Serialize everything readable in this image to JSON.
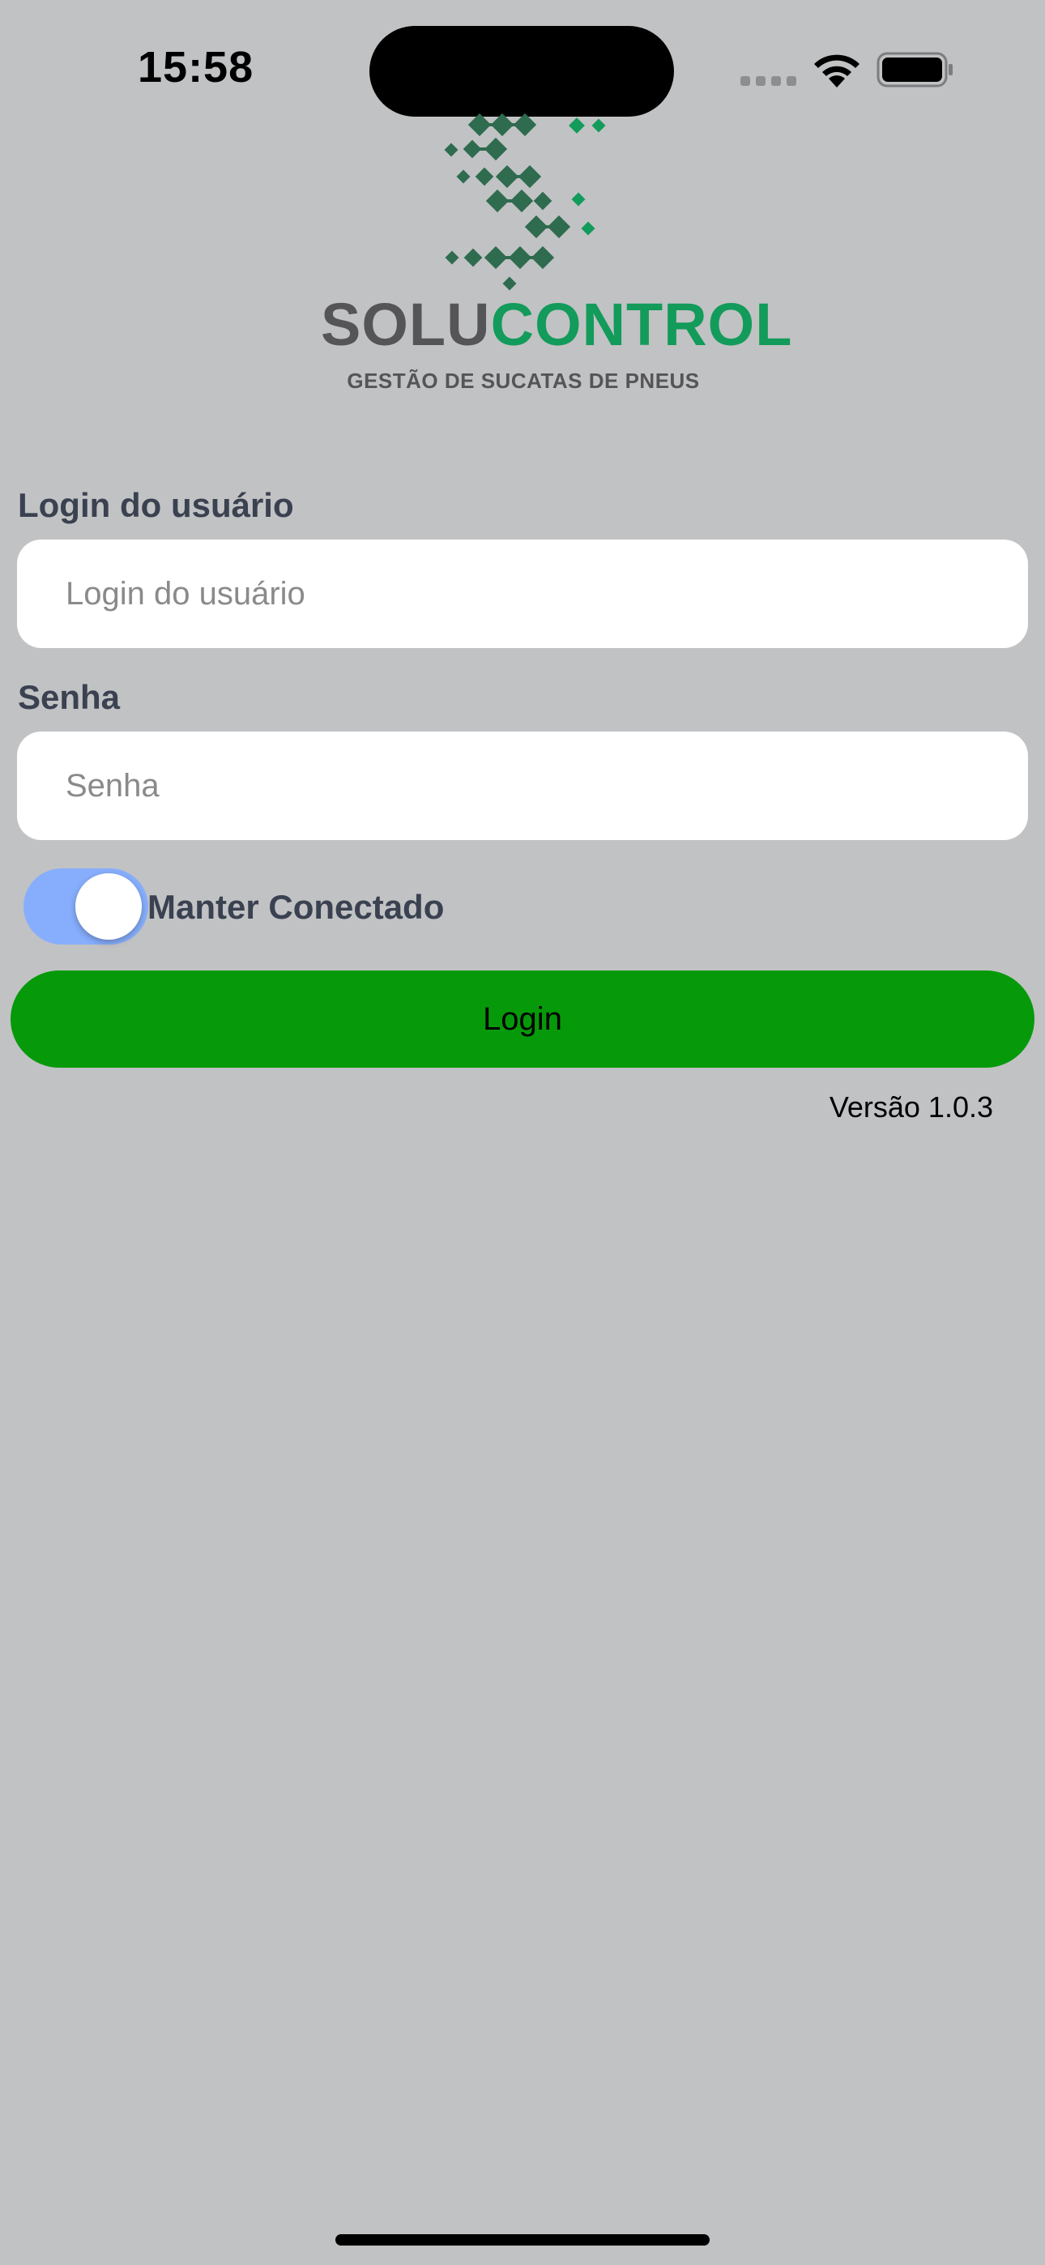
{
  "status_bar": {
    "time": "15:58",
    "signal_icon": "cellular-signal-icon",
    "wifi_icon": "wifi-icon",
    "battery_icon": "battery-icon"
  },
  "logo": {
    "brand_part1": "SOLU",
    "brand_part2": "CONTROL",
    "tagline": "GESTÃO DE SUCATAS DE PNEUS",
    "colors": {
      "gray": "#555557",
      "green": "#129b5a",
      "dark_green": "#2f6b4f"
    }
  },
  "form": {
    "username_label": "Login do usuário",
    "username_placeholder": "Login do usuário",
    "username_value": "",
    "password_label": "Senha",
    "password_placeholder": "Senha",
    "password_value": "",
    "keep_connected_label": "Manter Conectado",
    "keep_connected_on": true,
    "login_button_label": "Login"
  },
  "version": "Versão 1.0.3",
  "colors": {
    "background": "#c1c2c4",
    "login_button": "#06990a",
    "toggle_on": "#86aefc",
    "label_text": "#3a4150"
  }
}
